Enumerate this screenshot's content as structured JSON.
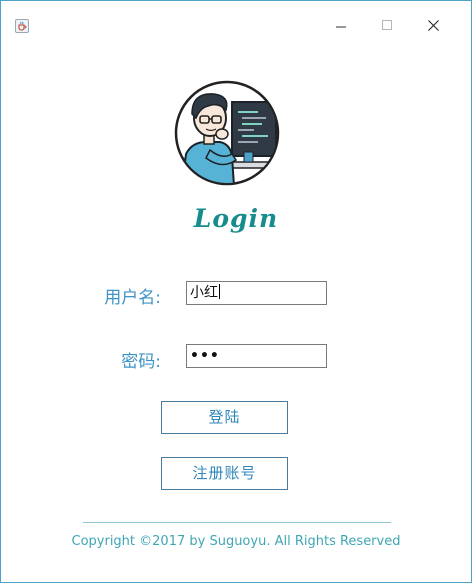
{
  "window": {
    "icons": {
      "app": "java-coffee-cup-icon",
      "minimize": "minimize-icon",
      "maximize": "maximize-icon",
      "close": "close-icon"
    }
  },
  "avatar": {
    "icon": "developer-at-computer-avatar"
  },
  "login": {
    "title": "Login",
    "username_label": "用户名:",
    "username_value": "小红",
    "password_label": "密码:",
    "password_masked": "•••",
    "login_button": "登陆",
    "register_button": "注册账号"
  },
  "footer": {
    "copyright": "Copyright ©2017 by Suguoyu. All Rights Reserved"
  },
  "colors": {
    "accent": "#3d93c6",
    "title": "#168c8c",
    "footer": "#3fa6b4",
    "window_border": "#4fa3c7"
  }
}
